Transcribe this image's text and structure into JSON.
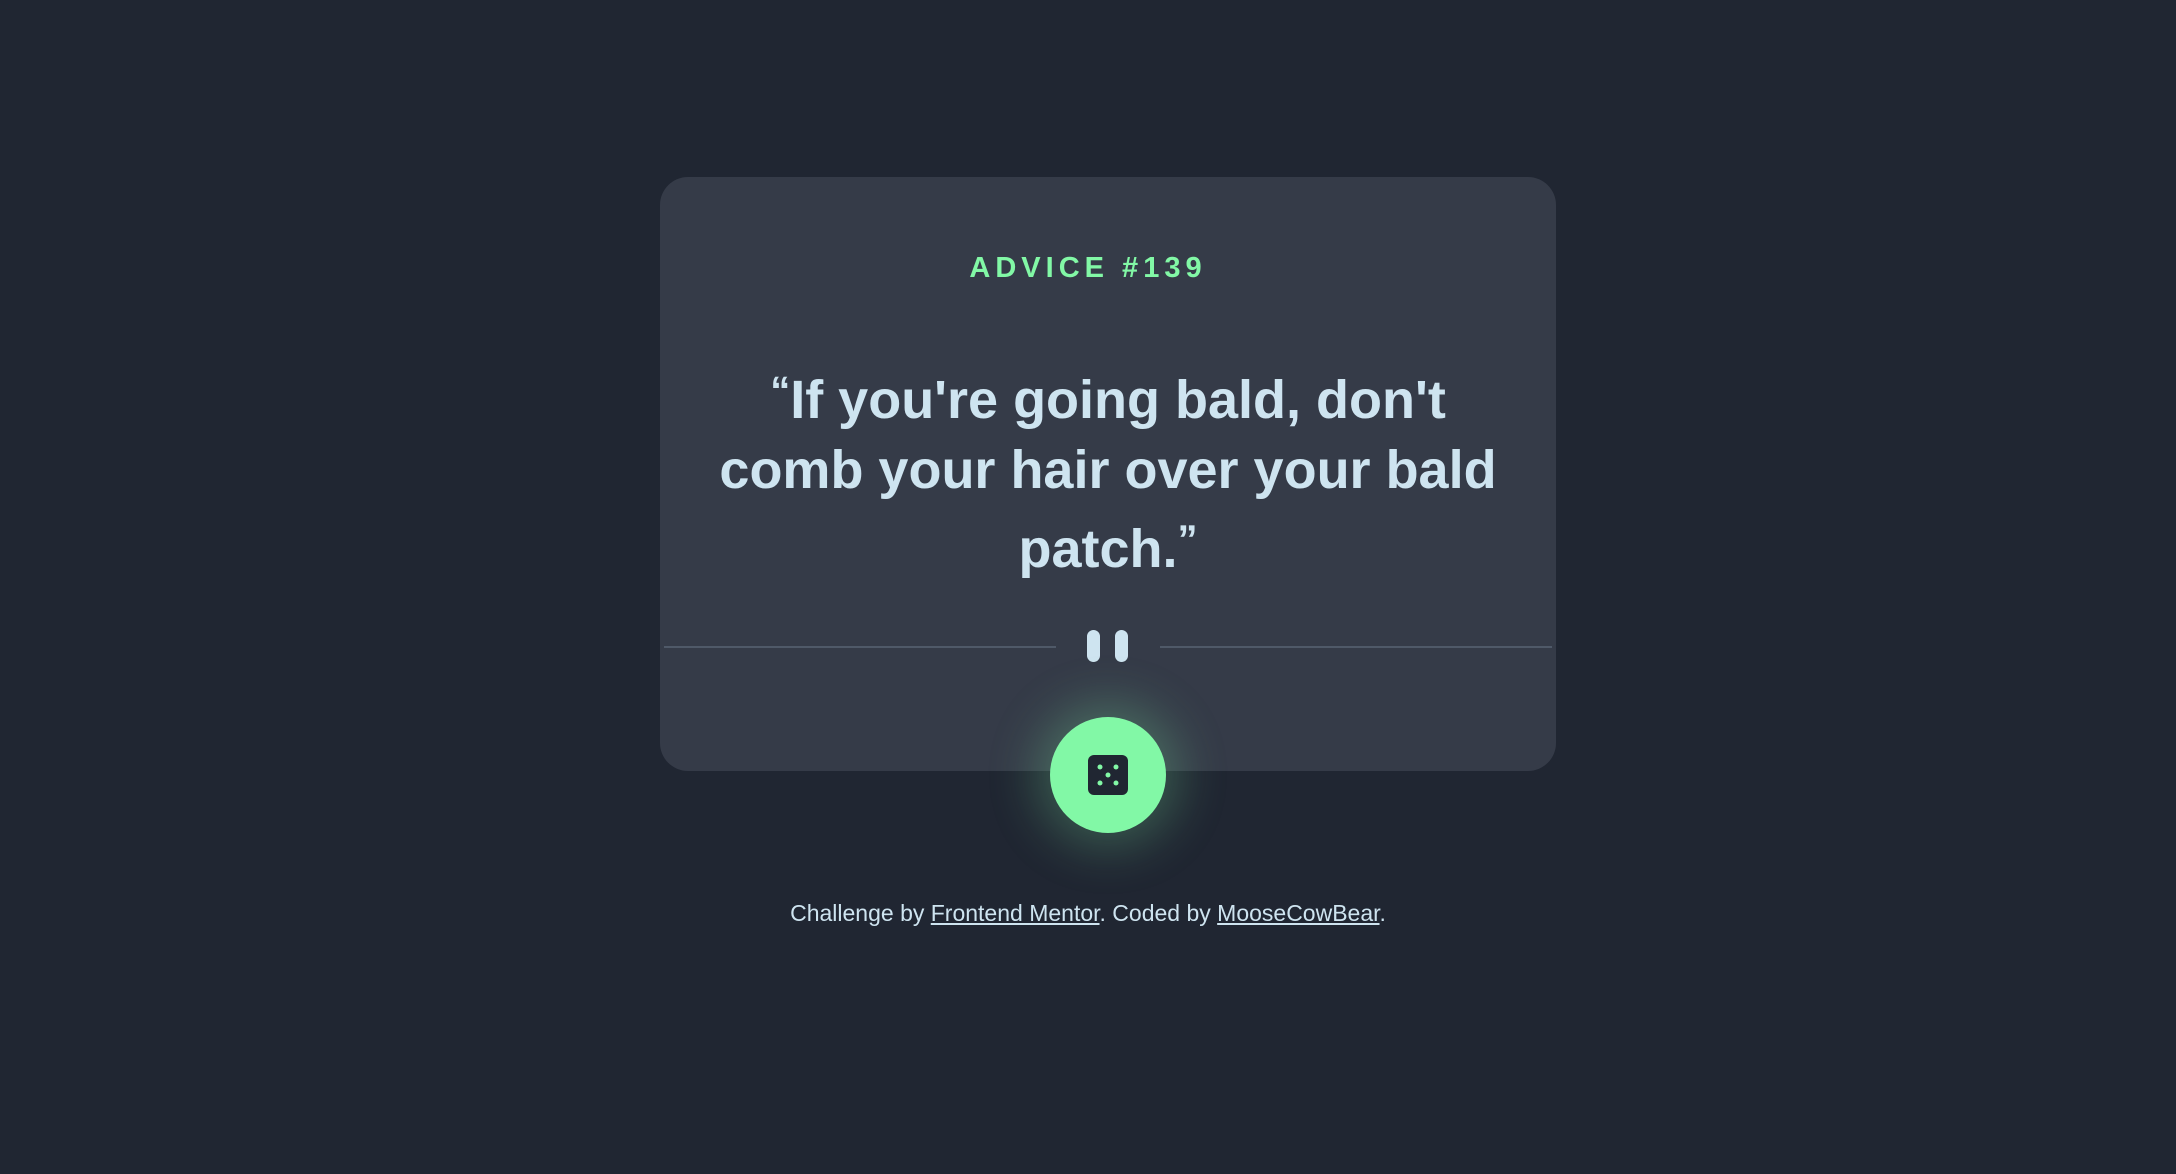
{
  "advice": {
    "label": "ADVICE",
    "number": "139",
    "quote_open": "“",
    "quote_text": "If you're going bald, don't comb your hair over your bald patch.",
    "quote_close": "”"
  },
  "divider": {
    "icon": "pause-icon"
  },
  "button": {
    "icon": "dice-icon"
  },
  "footer": {
    "prefix": "Challenge by",
    "link1": "Frontend Mentor",
    "middle": ". Coded by",
    "link2": "MooseCowBear",
    "suffix": "."
  },
  "colors": {
    "background": "#202632",
    "card": "#353b48",
    "accent": "#82f8a6",
    "text": "#cee4f0"
  }
}
